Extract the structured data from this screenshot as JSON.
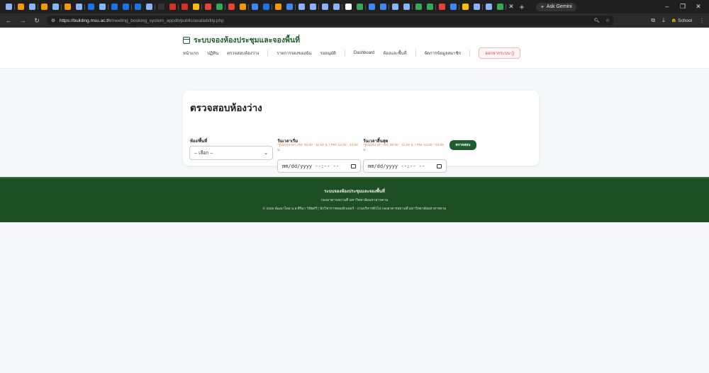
{
  "browser": {
    "tab_favicons": [
      "#8ab4f8",
      "#f29900",
      "#8ab4f8",
      "#f29900",
      "#8ab4f8",
      "#f29900",
      "#8ab4f8",
      "#1a73e8",
      "#8ab4f8",
      "#1a73e8",
      "#1a73e8",
      "#1a73e8",
      "#8ab4f8",
      "#333333",
      "#d93025",
      "#d93025",
      "#fbbc04",
      "#ea4335",
      "#34a853",
      "#ea4335",
      "#f29900",
      "#4285f4",
      "#1a73e8",
      "#f29900",
      "#4285f4",
      "#8ab4f8",
      "#8ab4f8",
      "#8ab4f8",
      "#8ab4f8",
      "#ffffff",
      "#34a853",
      "#4285f4",
      "#4285f4",
      "#8ab4f8",
      "#8ab4f8",
      "#34a853",
      "#34a853",
      "#ea4335",
      "#4285f4",
      "#fbbc04",
      "#8ab4f8",
      "#8ab4f8",
      "#34a853"
    ],
    "ask_gemini": "Ask Gemini",
    "url_host": "https://building.msu.ac.th",
    "url_path": "/meeting_booking_system_appdb/public/availability.php",
    "profile_label": "School"
  },
  "site": {
    "brand_title": "ระบบจองห้องประชุมและจองพื้นที่",
    "nav": {
      "home": "หน้าแรก",
      "calendar": "ปฏิทิน",
      "check_room": "ตรวจสอบห้องว่าง",
      "my_bookings": "รายการจองของฉัน",
      "approve": "รออนุมัติ",
      "dashboard": "Dashboard",
      "rooms": "ห้องและพื้นที่",
      "members": "จัดการข้อมูลสมาชิก",
      "logout": "ออกจากระบบ ()"
    }
  },
  "form": {
    "title": "ตรวจสอบห้องว่าง",
    "room_label": "ห้อง/พื้นที่",
    "room_selected": "-- เลือก --",
    "start_label": "วันเวลาเริ่ม",
    "start_hint": "*รูปแบบเวลา AM: 00:00 - 11:59 น. / PM: 12:00 - 23:59 น.",
    "start_value": "mm/dd/yyyy --:-- --",
    "end_label": "วันเวลาสิ้นสุด",
    "end_hint": "*รูปแบบเวลา AM: 00:00 - 11:59 น. / PM: 12:00 - 23:59 น.",
    "end_value": "mm/dd/yyyy --:-- --",
    "check_button": "ตรวจสอบ"
  },
  "footer": {
    "line1": "ระบบจองห้องประชุมและจองพื้นที่",
    "line2": "กองอาคารสถานที่ มหาวิทยาลัยมหาสารคาม",
    "line3": "© 2026 พัฒนาโดย น.ส.ศิริมา วิชัยศรี | นักวิชาการคอมพิวเตอร์ - งานบริหารทั่วไป กองอาคารสถานที่ มหาวิทยาลัยมหาสารคาม"
  }
}
